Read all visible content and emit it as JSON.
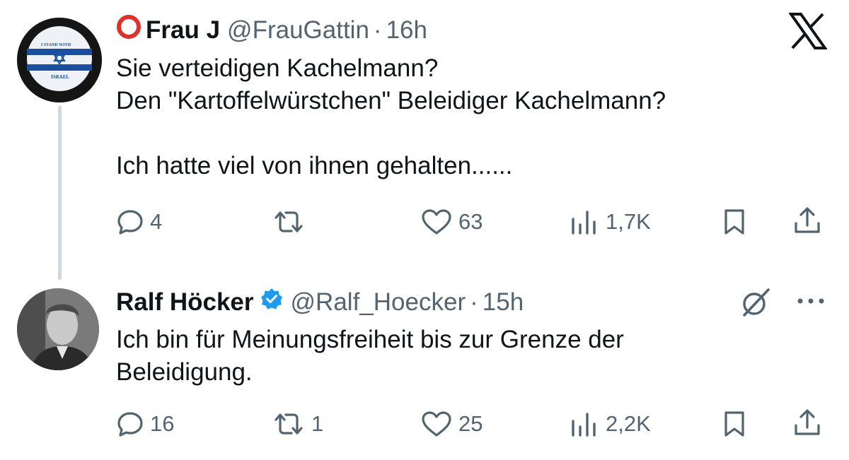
{
  "colors": {
    "text": "#0f1419",
    "muted": "#536471",
    "verified": "#1d9bf0",
    "thread_line": "#cfd9de",
    "red_circle": "#e0302a"
  },
  "app_logo_icon": "x-logo-icon",
  "tweets": [
    {
      "name": "Frau J",
      "prefix_icon": "red-circle-icon",
      "handle": "@FrauGattin",
      "separator": "·",
      "time": "16h",
      "avatar_icon": "i-stand-with-israel-badge-icon",
      "avatar_text_top": "I STAND WITH",
      "avatar_text_bottom": "ISRAEL",
      "text": "Sie verteidigen Kachelmann?\nDen \"Kartoffelwürstchen\"  Beleidiger Kachelmann?\n\nIch hatte viel von ihnen gehalten......",
      "actions": {
        "reply": "4",
        "retweet": "",
        "like": "63",
        "views": "1,7K"
      }
    },
    {
      "name": "Ralf Höcker",
      "verified_icon": "verified-badge-icon",
      "handle": "@Ralf_Hoecker",
      "separator": "·",
      "time": "15h",
      "avatar_icon": "profile-photo-icon",
      "grok_icon": "grok-icon",
      "more_icon": "more-dots-icon",
      "text": "Ich bin für Meinungsfreiheit bis zur Grenze der\nBeleidigung.",
      "actions": {
        "reply": "16",
        "retweet": "1",
        "like": "25",
        "views": "2,2K"
      }
    }
  ]
}
